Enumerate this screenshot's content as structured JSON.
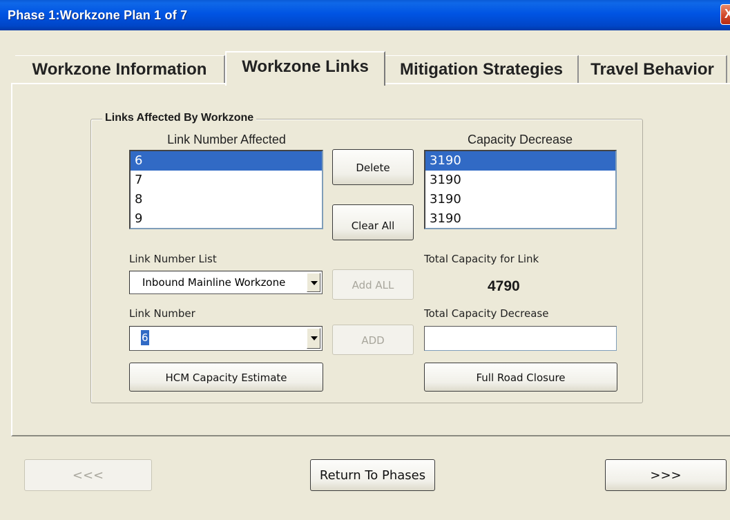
{
  "window": {
    "title": "Phase 1:Workzone Plan 1 of 7",
    "close_glyph": "X"
  },
  "tabs": [
    {
      "label": "Workzone Information"
    },
    {
      "label": "Workzone Links"
    },
    {
      "label": "Mitigation Strategies"
    },
    {
      "label": "Travel Behavior"
    }
  ],
  "active_tab": "Workzone Links",
  "group": {
    "label": "Links Affected By Workzone",
    "link_header": "Link Number Affected",
    "capacity_header": "Capacity Decrease",
    "link_rows": [
      "6",
      "7",
      "8",
      "9"
    ],
    "capacity_rows": [
      "3190",
      "3190",
      "3190",
      "3190"
    ],
    "selected_index": 0,
    "delete_label": "Delete",
    "clear_all_label": "Clear All",
    "link_number_list_label": "Link Number List",
    "link_number_list_value": "Inbound Mainline Workzone",
    "add_all_label": "Add ALL",
    "total_capacity_label": "Total Capacity for Link",
    "total_capacity_value": "4790",
    "link_number_label": "Link Number",
    "link_number_value": "6",
    "add_label": "ADD",
    "total_capacity_decrease_label": "Total Capacity Decrease",
    "total_capacity_decrease_value": "",
    "hcm_label": "HCM Capacity Estimate",
    "full_closure_label": "Full Road Closure"
  },
  "nav": {
    "prev_label": "<<<",
    "return_label": "Return To Phases",
    "next_label": ">>>"
  },
  "colors": {
    "title_bar": "#0054e3",
    "selection": "#316ac5",
    "window_bg": "#ece9d8"
  }
}
